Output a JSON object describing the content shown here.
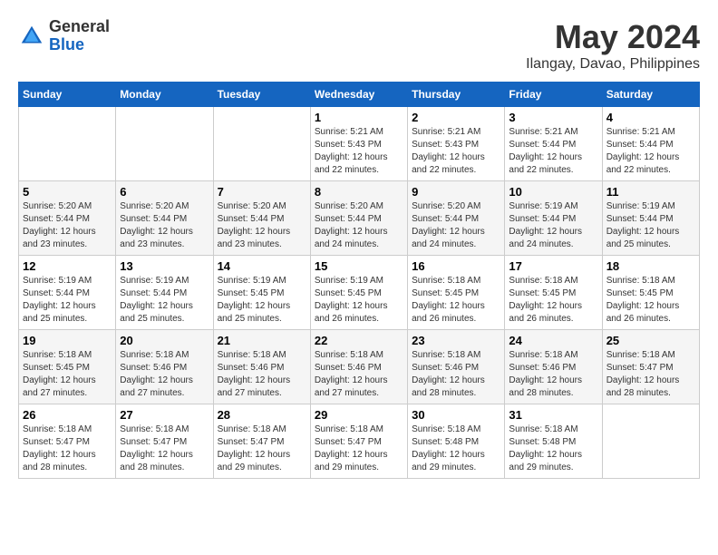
{
  "header": {
    "logo_line1": "General",
    "logo_line2": "Blue",
    "month": "May 2024",
    "location": "Ilangay, Davao, Philippines"
  },
  "weekdays": [
    "Sunday",
    "Monday",
    "Tuesday",
    "Wednesday",
    "Thursday",
    "Friday",
    "Saturday"
  ],
  "weeks": [
    [
      {
        "day": "",
        "info": ""
      },
      {
        "day": "",
        "info": ""
      },
      {
        "day": "",
        "info": ""
      },
      {
        "day": "1",
        "info": "Sunrise: 5:21 AM\nSunset: 5:43 PM\nDaylight: 12 hours and 22 minutes."
      },
      {
        "day": "2",
        "info": "Sunrise: 5:21 AM\nSunset: 5:43 PM\nDaylight: 12 hours and 22 minutes."
      },
      {
        "day": "3",
        "info": "Sunrise: 5:21 AM\nSunset: 5:44 PM\nDaylight: 12 hours and 22 minutes."
      },
      {
        "day": "4",
        "info": "Sunrise: 5:21 AM\nSunset: 5:44 PM\nDaylight: 12 hours and 22 minutes."
      }
    ],
    [
      {
        "day": "5",
        "info": "Sunrise: 5:20 AM\nSunset: 5:44 PM\nDaylight: 12 hours and 23 minutes."
      },
      {
        "day": "6",
        "info": "Sunrise: 5:20 AM\nSunset: 5:44 PM\nDaylight: 12 hours and 23 minutes."
      },
      {
        "day": "7",
        "info": "Sunrise: 5:20 AM\nSunset: 5:44 PM\nDaylight: 12 hours and 23 minutes."
      },
      {
        "day": "8",
        "info": "Sunrise: 5:20 AM\nSunset: 5:44 PM\nDaylight: 12 hours and 24 minutes."
      },
      {
        "day": "9",
        "info": "Sunrise: 5:20 AM\nSunset: 5:44 PM\nDaylight: 12 hours and 24 minutes."
      },
      {
        "day": "10",
        "info": "Sunrise: 5:19 AM\nSunset: 5:44 PM\nDaylight: 12 hours and 24 minutes."
      },
      {
        "day": "11",
        "info": "Sunrise: 5:19 AM\nSunset: 5:44 PM\nDaylight: 12 hours and 25 minutes."
      }
    ],
    [
      {
        "day": "12",
        "info": "Sunrise: 5:19 AM\nSunset: 5:44 PM\nDaylight: 12 hours and 25 minutes."
      },
      {
        "day": "13",
        "info": "Sunrise: 5:19 AM\nSunset: 5:44 PM\nDaylight: 12 hours and 25 minutes."
      },
      {
        "day": "14",
        "info": "Sunrise: 5:19 AM\nSunset: 5:45 PM\nDaylight: 12 hours and 25 minutes."
      },
      {
        "day": "15",
        "info": "Sunrise: 5:19 AM\nSunset: 5:45 PM\nDaylight: 12 hours and 26 minutes."
      },
      {
        "day": "16",
        "info": "Sunrise: 5:18 AM\nSunset: 5:45 PM\nDaylight: 12 hours and 26 minutes."
      },
      {
        "day": "17",
        "info": "Sunrise: 5:18 AM\nSunset: 5:45 PM\nDaylight: 12 hours and 26 minutes."
      },
      {
        "day": "18",
        "info": "Sunrise: 5:18 AM\nSunset: 5:45 PM\nDaylight: 12 hours and 26 minutes."
      }
    ],
    [
      {
        "day": "19",
        "info": "Sunrise: 5:18 AM\nSunset: 5:45 PM\nDaylight: 12 hours and 27 minutes."
      },
      {
        "day": "20",
        "info": "Sunrise: 5:18 AM\nSunset: 5:46 PM\nDaylight: 12 hours and 27 minutes."
      },
      {
        "day": "21",
        "info": "Sunrise: 5:18 AM\nSunset: 5:46 PM\nDaylight: 12 hours and 27 minutes."
      },
      {
        "day": "22",
        "info": "Sunrise: 5:18 AM\nSunset: 5:46 PM\nDaylight: 12 hours and 27 minutes."
      },
      {
        "day": "23",
        "info": "Sunrise: 5:18 AM\nSunset: 5:46 PM\nDaylight: 12 hours and 28 minutes."
      },
      {
        "day": "24",
        "info": "Sunrise: 5:18 AM\nSunset: 5:46 PM\nDaylight: 12 hours and 28 minutes."
      },
      {
        "day": "25",
        "info": "Sunrise: 5:18 AM\nSunset: 5:47 PM\nDaylight: 12 hours and 28 minutes."
      }
    ],
    [
      {
        "day": "26",
        "info": "Sunrise: 5:18 AM\nSunset: 5:47 PM\nDaylight: 12 hours and 28 minutes."
      },
      {
        "day": "27",
        "info": "Sunrise: 5:18 AM\nSunset: 5:47 PM\nDaylight: 12 hours and 28 minutes."
      },
      {
        "day": "28",
        "info": "Sunrise: 5:18 AM\nSunset: 5:47 PM\nDaylight: 12 hours and 29 minutes."
      },
      {
        "day": "29",
        "info": "Sunrise: 5:18 AM\nSunset: 5:47 PM\nDaylight: 12 hours and 29 minutes."
      },
      {
        "day": "30",
        "info": "Sunrise: 5:18 AM\nSunset: 5:48 PM\nDaylight: 12 hours and 29 minutes."
      },
      {
        "day": "31",
        "info": "Sunrise: 5:18 AM\nSunset: 5:48 PM\nDaylight: 12 hours and 29 minutes."
      },
      {
        "day": "",
        "info": ""
      }
    ]
  ]
}
